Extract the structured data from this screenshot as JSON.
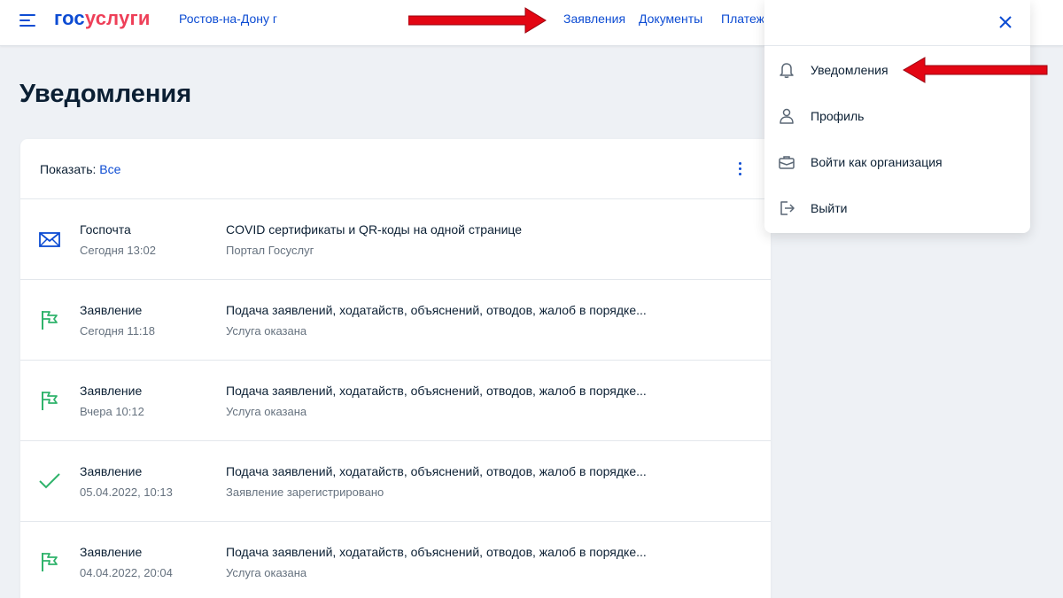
{
  "header": {
    "logo": {
      "part1": "гос",
      "part2": "услуги"
    },
    "city": "Ростов-на-Дону г",
    "nav": [
      {
        "label": "Заявления"
      },
      {
        "label": "Документы"
      },
      {
        "label": "Платежи"
      }
    ]
  },
  "page": {
    "title": "Уведомления",
    "filter": {
      "label": "Показать:",
      "value": "Все"
    }
  },
  "notifications": [
    {
      "icon": "envelope-icon",
      "type": "Госпочта",
      "date": "Сегодня 13:02",
      "subject": "COVID сертификаты и QR-коды на одной странице",
      "status": "Портал Госуслуг"
    },
    {
      "icon": "flag-icon",
      "type": "Заявление",
      "date": "Сегодня 11:18",
      "subject": "Подача заявлений, ходатайств, объяснений, отводов, жалоб в порядке...",
      "status": "Услуга оказана"
    },
    {
      "icon": "flag-icon",
      "type": "Заявление",
      "date": "Вчера 10:12",
      "subject": "Подача заявлений, ходатайств, объяснений, отводов, жалоб в порядке...",
      "status": "Услуга оказана"
    },
    {
      "icon": "checkmark-icon",
      "type": "Заявление",
      "date": "05.04.2022, 10:13",
      "subject": "Подача заявлений, ходатайств, объяснений, отводов, жалоб в порядке...",
      "status": "Заявление зарегистрировано"
    },
    {
      "icon": "flag-icon",
      "type": "Заявление",
      "date": "04.04.2022, 20:04",
      "subject": "Подача заявлений, ходатайств, объяснений, отводов, жалоб в порядке...",
      "status": "Услуга оказана"
    }
  ],
  "dropdown": {
    "items": [
      {
        "icon": "bell-icon",
        "label": "Уведомления"
      },
      {
        "icon": "person-icon",
        "label": "Профиль"
      },
      {
        "icon": "briefcase-icon",
        "label": "Войти как организация"
      },
      {
        "icon": "logout-icon",
        "label": "Выйти"
      }
    ]
  },
  "colors": {
    "brand_blue": "#0d4cd3",
    "brand_red": "#ee3f58",
    "status_green": "#2fb36b",
    "annotation_red": "#e30613"
  }
}
